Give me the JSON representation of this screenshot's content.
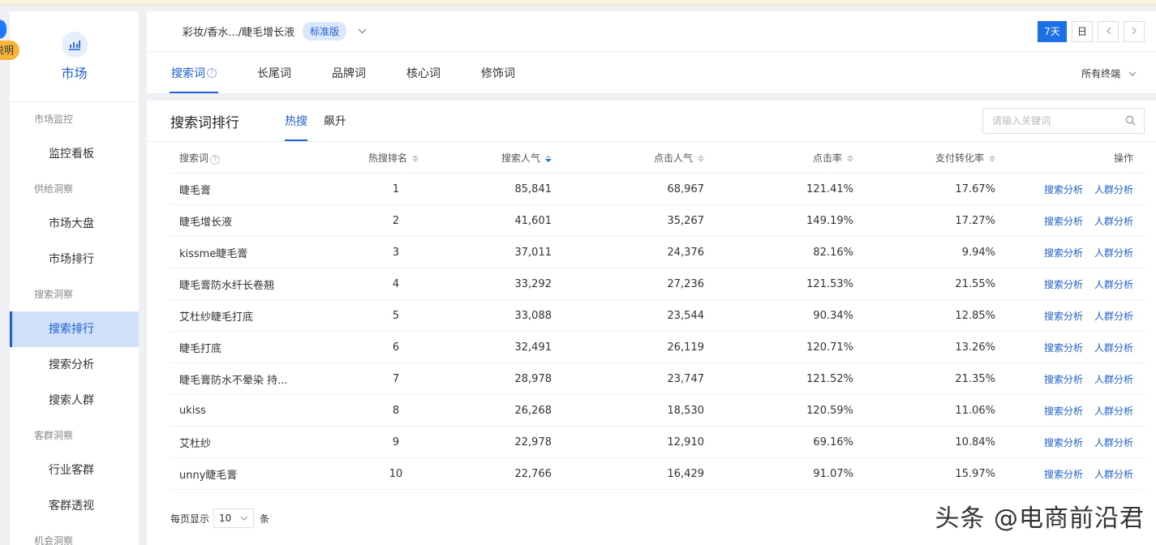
{
  "badge": {
    "text": "说明"
  },
  "sidebar": {
    "brand_label": "市场",
    "sections": [
      {
        "group": "市场监控",
        "items": [
          "监控看板"
        ]
      },
      {
        "group": "供给洞察",
        "items": [
          "市场大盘",
          "市场排行"
        ]
      },
      {
        "group": "搜索洞察",
        "items": [
          "搜索排行",
          "搜索分析",
          "搜索人群"
        ]
      },
      {
        "group": "客群洞察",
        "items": [
          "行业客群",
          "客群透视"
        ]
      },
      {
        "group": "机会洞察",
        "items": []
      }
    ],
    "active_item": "搜索排行"
  },
  "header": {
    "breadcrumb": "彩妆/香水.../睫毛增长液",
    "edition_badge": "标准版",
    "date_range_active": "7天",
    "date_day": "日",
    "tabs": [
      "搜索词",
      "长尾词",
      "品牌词",
      "核心词",
      "修饰词"
    ],
    "active_tab": "搜索词",
    "terminal": "所有终端"
  },
  "main": {
    "title": "搜索词排行",
    "subtabs": [
      "热搜",
      "飙升"
    ],
    "active_subtab": "热搜",
    "search_placeholder": "请输入关键词",
    "columns": [
      "搜索词",
      "热搜排名",
      "搜索人气",
      "点击人气",
      "点击率",
      "支付转化率",
      "操作"
    ],
    "actions": [
      "搜索分析",
      "人群分析"
    ],
    "rows": [
      [
        "睫毛膏",
        "1",
        "85,841",
        "68,967",
        "121.41%",
        "17.67%"
      ],
      [
        "睫毛增长液",
        "2",
        "41,601",
        "35,267",
        "149.19%",
        "17.27%"
      ],
      [
        "kissme睫毛膏",
        "3",
        "37,011",
        "24,376",
        "82.16%",
        "9.94%"
      ],
      [
        "睫毛膏防水纤长卷翘",
        "4",
        "33,292",
        "27,236",
        "121.53%",
        "21.55%"
      ],
      [
        "艾杜纱睫毛打底",
        "5",
        "33,088",
        "23,544",
        "90.34%",
        "12.85%"
      ],
      [
        "睫毛打底",
        "6",
        "32,491",
        "26,119",
        "120.71%",
        "13.26%"
      ],
      [
        "睫毛膏防水不晕染 持...",
        "7",
        "28,978",
        "23,747",
        "121.52%",
        "21.35%"
      ],
      [
        "ukiss",
        "8",
        "26,268",
        "18,530",
        "120.59%",
        "11.06%"
      ],
      [
        "艾杜纱",
        "9",
        "22,978",
        "12,910",
        "69.16%",
        "10.84%"
      ],
      [
        "unny睫毛膏",
        "10",
        "22,766",
        "16,429",
        "91.07%",
        "15.97%"
      ]
    ],
    "pager": {
      "prefix": "每页显示",
      "value": "10",
      "suffix": "条"
    }
  },
  "watermark": "头条 @电商前沿君",
  "colors": {
    "accent": "#1d5fd6",
    "active_bg": "#cfe0f8",
    "badge": "#f7b63a"
  }
}
